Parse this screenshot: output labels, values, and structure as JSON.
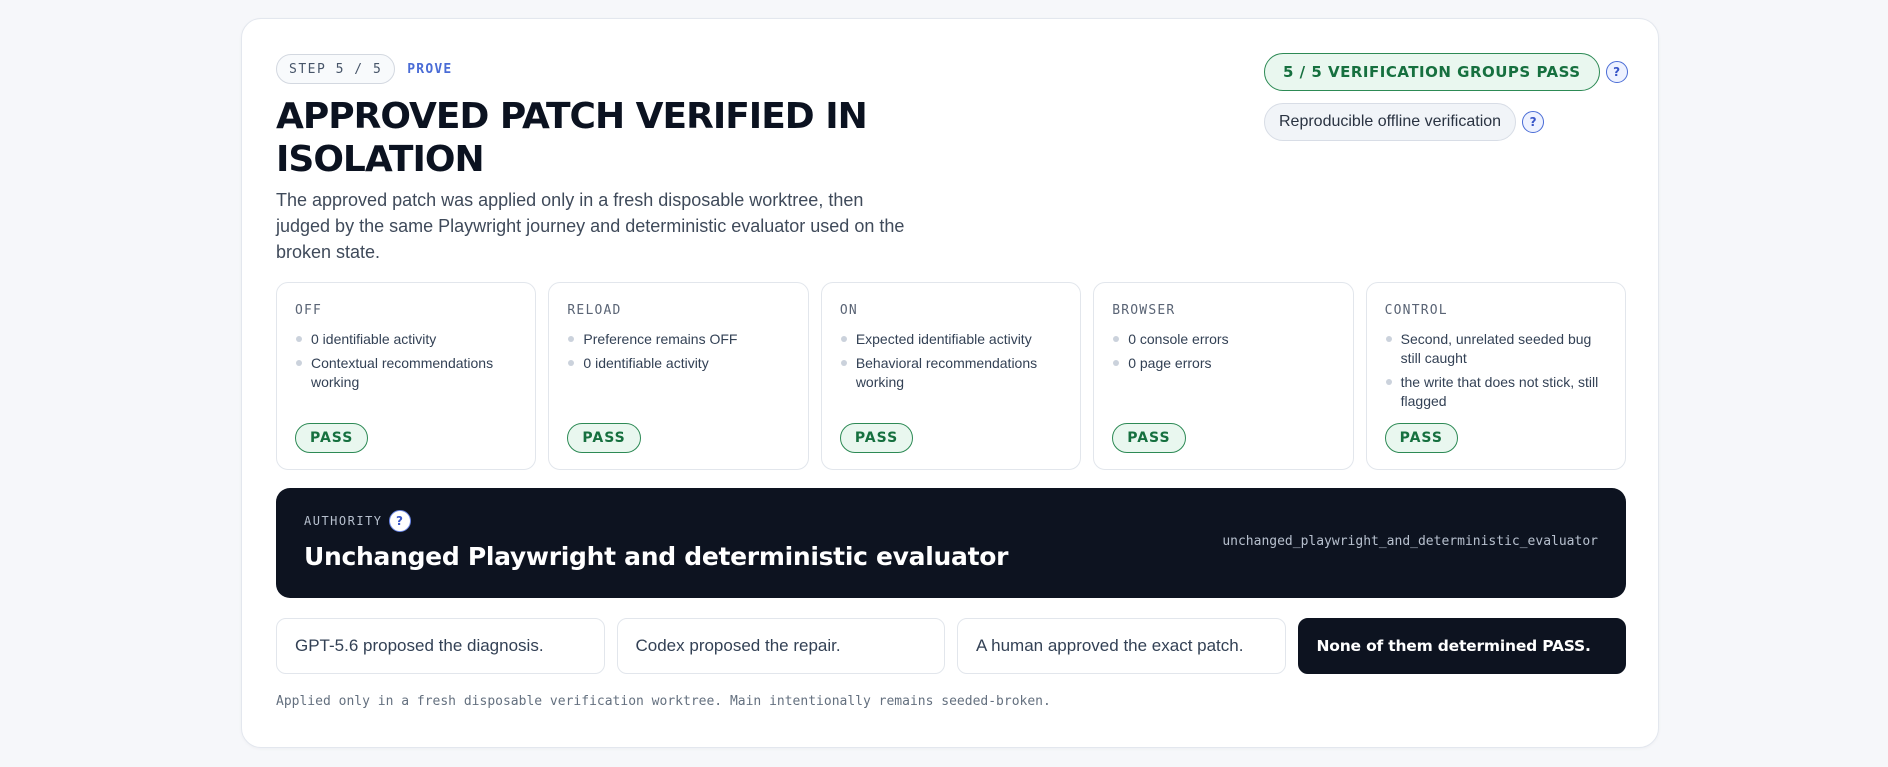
{
  "header": {
    "step": "STEP 5 / 5",
    "phase": "PROVE",
    "title": "APPROVED PATCH VERIFIED IN ISOLATION",
    "description": "The approved patch was applied only in a fresh disposable worktree, then judged by the same Playwright journey and deterministic evaluator used on the broken state."
  },
  "badges": {
    "verification": "5 / 5 VERIFICATION GROUPS PASS",
    "offline": "Reproducible offline verification",
    "help_icon_glyph": "?"
  },
  "groups": [
    {
      "label": "OFF",
      "items": [
        "0 identifiable activity",
        "Contextual recommendations working"
      ],
      "status": "PASS"
    },
    {
      "label": "RELOAD",
      "items": [
        "Preference remains OFF",
        "0 identifiable activity"
      ],
      "status": "PASS"
    },
    {
      "label": "ON",
      "items": [
        "Expected identifiable activity",
        "Behavioral recommendations working"
      ],
      "status": "PASS"
    },
    {
      "label": "BROWSER",
      "items": [
        "0 console errors",
        "0 page errors"
      ],
      "status": "PASS"
    },
    {
      "label": "CONTROL",
      "items": [
        "Second, unrelated seeded bug still caught",
        "the write that does not stick, still flagged"
      ],
      "status": "PASS"
    }
  ],
  "authority": {
    "label": "AUTHORITY",
    "title": "Unchanged Playwright and deterministic evaluator",
    "code": "unchanged_playwright_and_deterministic_evaluator"
  },
  "actors": [
    "GPT-5.6 proposed the diagnosis.",
    "Codex proposed the repair.",
    "A human approved the exact patch.",
    "None of them determined PASS."
  ],
  "footnote": "Applied only in a fresh disposable verification worktree. Main intentionally remains seeded-broken.",
  "colors": {
    "pass_green": "#16703f",
    "accent_blue": "#4a6cd6",
    "dark_panel": "#0d1320"
  }
}
